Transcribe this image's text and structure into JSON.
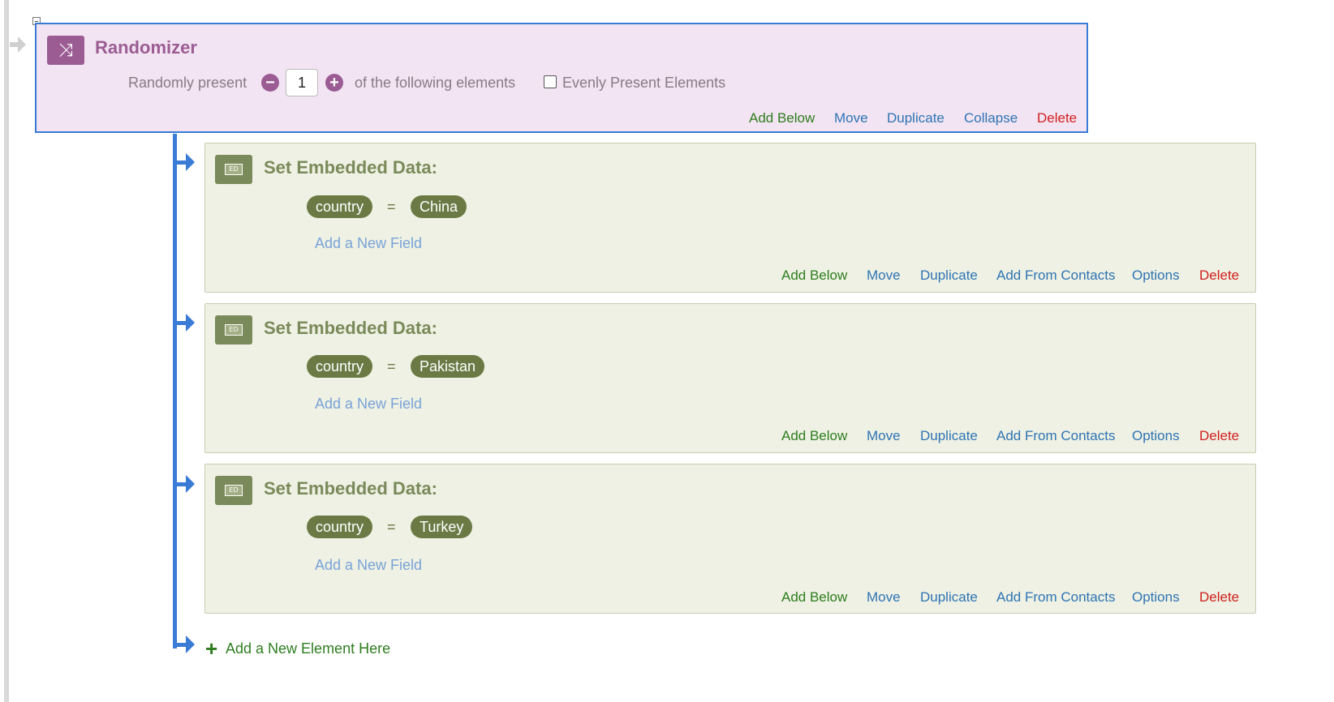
{
  "randomizer": {
    "title": "Randomizer",
    "present_prefix": "Randomly present",
    "count_value": "1",
    "present_suffix": "of the following elements",
    "evenly_label": "Evenly Present Elements",
    "evenly_checked": false,
    "actions": {
      "add_below": "Add Below",
      "move": "Move",
      "duplicate": "Duplicate",
      "collapse": "Collapse",
      "delete": "Delete"
    }
  },
  "embedded_blocks": [
    {
      "title": "Set Embedded Data:",
      "icon_label": "ED",
      "field": "country",
      "equals": "=",
      "value": "China",
      "add_field": "Add a New Field",
      "actions": {
        "add_below": "Add Below",
        "move": "Move",
        "duplicate": "Duplicate",
        "add_from_contacts": "Add From Contacts",
        "options": "Options",
        "delete": "Delete"
      }
    },
    {
      "title": "Set Embedded Data:",
      "icon_label": "ED",
      "field": "country",
      "equals": "=",
      "value": "Pakistan",
      "add_field": "Add a New Field",
      "actions": {
        "add_below": "Add Below",
        "move": "Move",
        "duplicate": "Duplicate",
        "add_from_contacts": "Add From Contacts",
        "options": "Options",
        "delete": "Delete"
      }
    },
    {
      "title": "Set Embedded Data:",
      "icon_label": "ED",
      "field": "country",
      "equals": "=",
      "value": "Turkey",
      "add_field": "Add a New Field",
      "actions": {
        "add_below": "Add Below",
        "move": "Move",
        "duplicate": "Duplicate",
        "add_from_contacts": "Add From Contacts",
        "options": "Options",
        "delete": "Delete"
      }
    }
  ],
  "add_element": {
    "plus": "+",
    "label": "Add a New Element Here"
  },
  "icons": {
    "randomizer": "shuffle-icon",
    "minus": "minus-circle-icon",
    "plus": "plus-circle-icon",
    "embedded_data": "embedded-data-icon"
  },
  "colors": {
    "randomizer_bg": "#f2e4f2",
    "randomizer_accent": "#9b5c93",
    "embedded_bg": "#eef1e3",
    "embedded_accent": "#6b7a45",
    "connector": "#3a7bd5",
    "action_green": "#2e7d1f",
    "action_blue": "#2f74b5",
    "action_red": "#d21f1f"
  }
}
